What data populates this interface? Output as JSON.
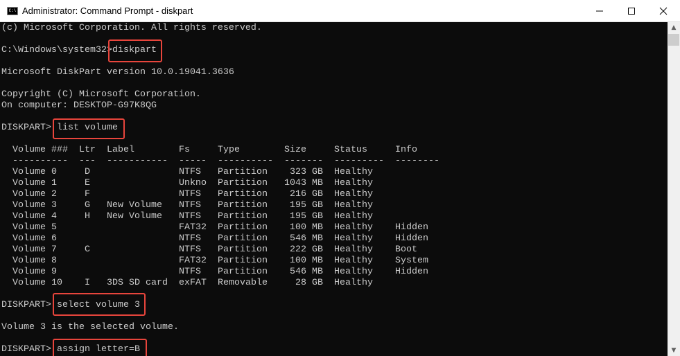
{
  "window": {
    "title": "Administrator: Command Prompt - diskpart",
    "icon": "cmd-icon",
    "minimize": "minimize-icon",
    "maximize": "maximize-icon",
    "close": "close-icon"
  },
  "console": {
    "copyright_top": "(c) Microsoft Corporation. All rights reserved.",
    "prompt1": "C:\\Windows\\system32>",
    "cmd1": "diskpart",
    "version": "Microsoft DiskPart version 10.0.19041.3636",
    "copyright": "Copyright (C) Microsoft Corporation.",
    "computer": "On computer: DESKTOP-G97K8QG",
    "prompt": "DISKPART>",
    "cmd2": "list volume",
    "cmd3": "select volume 3",
    "selected_msg": "Volume 3 is the selected volume.",
    "cmd4": "assign letter=B"
  },
  "table": {
    "headers": [
      "Volume ###",
      "Ltr",
      "Label",
      "Fs",
      "Type",
      "Size",
      "Status",
      "Info"
    ],
    "dashes": [
      "----------",
      "---",
      "-----------",
      "-----",
      "----------",
      "-------",
      "---------",
      "--------"
    ],
    "rows": [
      [
        "Volume 0",
        "D",
        "",
        "NTFS",
        "Partition",
        "323 GB",
        "Healthy",
        ""
      ],
      [
        "Volume 1",
        "E",
        "",
        "Unkno",
        "Partition",
        "1043 MB",
        "Healthy",
        ""
      ],
      [
        "Volume 2",
        "F",
        "",
        "NTFS",
        "Partition",
        "216 GB",
        "Healthy",
        ""
      ],
      [
        "Volume 3",
        "G",
        "New Volume",
        "NTFS",
        "Partition",
        "195 GB",
        "Healthy",
        ""
      ],
      [
        "Volume 4",
        "H",
        "New Volume",
        "NTFS",
        "Partition",
        "195 GB",
        "Healthy",
        ""
      ],
      [
        "Volume 5",
        "",
        "",
        "FAT32",
        "Partition",
        "100 MB",
        "Healthy",
        "Hidden"
      ],
      [
        "Volume 6",
        "",
        "",
        "NTFS",
        "Partition",
        "546 MB",
        "Healthy",
        "Hidden"
      ],
      [
        "Volume 7",
        "C",
        "",
        "NTFS",
        "Partition",
        "222 GB",
        "Healthy",
        "Boot"
      ],
      [
        "Volume 8",
        "",
        "",
        "FAT32",
        "Partition",
        "100 MB",
        "Healthy",
        "System"
      ],
      [
        "Volume 9",
        "",
        "",
        "NTFS",
        "Partition",
        "546 MB",
        "Healthy",
        "Hidden"
      ],
      [
        "Volume 10",
        "I",
        "3DS SD card",
        "exFAT",
        "Removable",
        "28 GB",
        "Healthy",
        ""
      ]
    ]
  },
  "colors": {
    "highlight": "#e8453c",
    "text": "#cccccc",
    "background": "#0c0c0c"
  }
}
